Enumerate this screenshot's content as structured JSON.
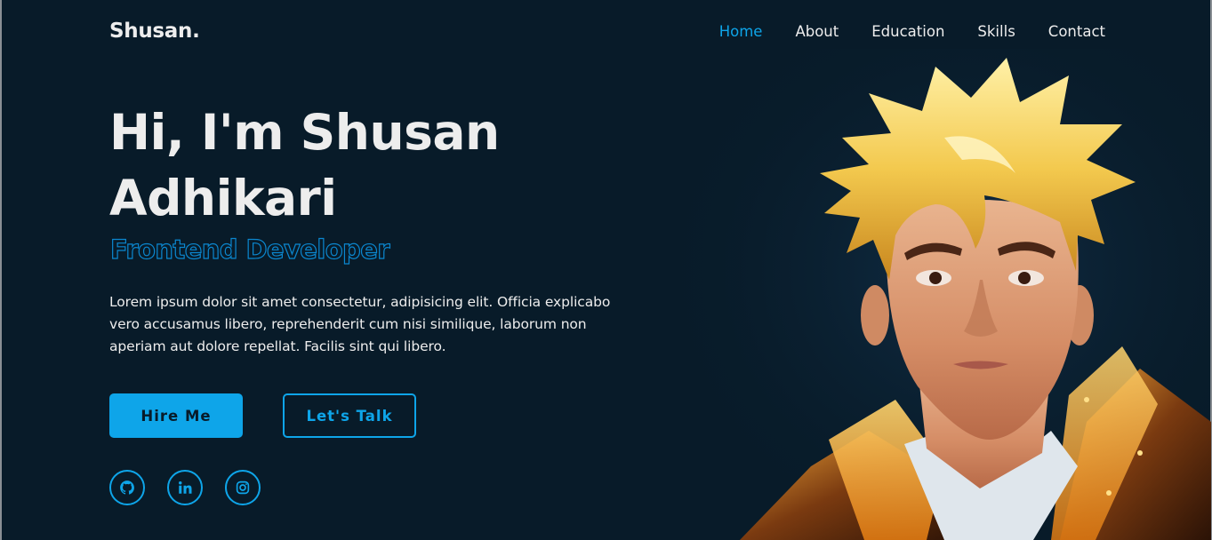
{
  "header": {
    "logo": "Shusan.",
    "nav": [
      {
        "label": "Home",
        "active": true
      },
      {
        "label": "About",
        "active": false
      },
      {
        "label": "Education",
        "active": false
      },
      {
        "label": "Skills",
        "active": false
      },
      {
        "label": "Contact",
        "active": false
      }
    ]
  },
  "hero": {
    "title": "Hi, I'm Shusan Adhikari",
    "role": "Frontend Developer",
    "description": "Lorem ipsum dolor sit amet consectetur, adipisicing elit. Officia explicabo vero accusamus libero, reprehenderit cum nisi similique, laborum non aperiam aut dolore repellat. Facilis sint qui libero.",
    "buttons": {
      "hire": "Hire Me",
      "talk": "Let's Talk"
    },
    "socials": [
      "github-icon",
      "linkedin-icon",
      "instagram-icon"
    ]
  },
  "colors": {
    "background": "#081b29",
    "accent": "#0ea5e9",
    "text": "#ededed"
  }
}
